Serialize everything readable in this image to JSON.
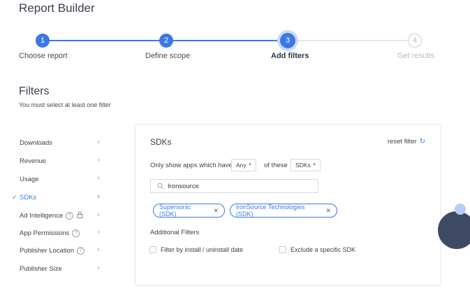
{
  "page": {
    "title": "Report Builder"
  },
  "stepper": {
    "steps": [
      {
        "number": "1",
        "label": "Choose report",
        "state": "done"
      },
      {
        "number": "2",
        "label": "Define scope",
        "state": "done"
      },
      {
        "number": "3",
        "label": "Add filters",
        "state": "current"
      },
      {
        "number": "4",
        "label": "Get results",
        "state": "todo"
      }
    ]
  },
  "filters": {
    "title": "Filters",
    "subtitle": "You must select at least one filter"
  },
  "sidebar": {
    "items": [
      {
        "label": "Downloads"
      },
      {
        "label": "Revenue"
      },
      {
        "label": "Usage"
      },
      {
        "label": "SDKs",
        "active": true
      },
      {
        "label": "Ad Intelligence",
        "help": true,
        "locked": true
      },
      {
        "label": "App Permissions",
        "help": true
      },
      {
        "label": "Publisher Location",
        "help": true
      },
      {
        "label": "Publisher Size"
      }
    ],
    "help_glyph": "?"
  },
  "panel": {
    "title": "SDKs",
    "reset_label": "reset filter",
    "only_show_label": "Only show apps which have",
    "any_select": "Any",
    "of_these_label": "of these",
    "sdks_select": "SDKs",
    "search_value": "Ironsource",
    "chips": [
      {
        "label": "Supersonic (SDK)"
      },
      {
        "label": "ironSource Technologies (SDK)"
      }
    ],
    "additional_filters_title": "Additional Filters",
    "checkbox_install": "Filter by install / uninstall date",
    "checkbox_exclude": "Exclude a specific SDK"
  },
  "colors": {
    "accent": "#3b79e4",
    "deco_dark": "#3e4a64"
  }
}
